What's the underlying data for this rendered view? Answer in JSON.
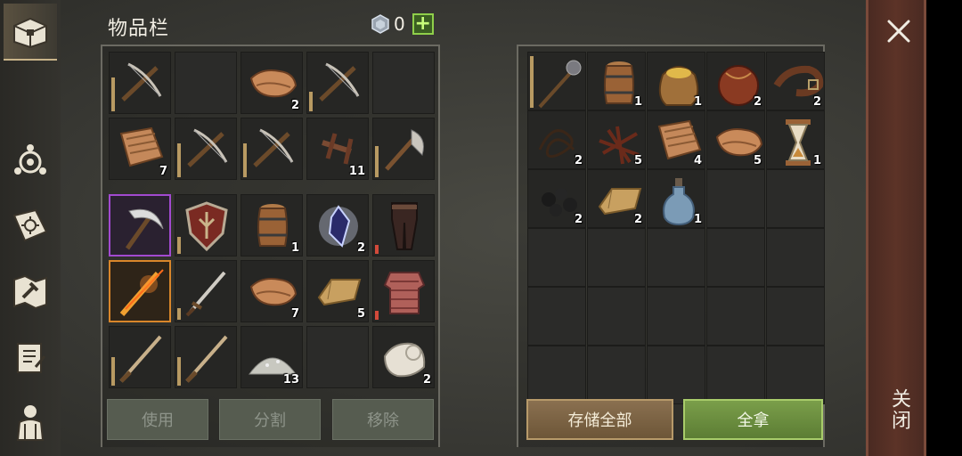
{
  "nav": {
    "items": [
      {
        "name": "storage-chest-icon",
        "active": true
      },
      {
        "name": "skills-icon",
        "active": false
      },
      {
        "name": "quest-book-icon",
        "active": false
      },
      {
        "name": "crafting-map-icon",
        "active": false
      },
      {
        "name": "recipe-scroll-icon",
        "active": false
      },
      {
        "name": "character-icon",
        "active": false
      }
    ]
  },
  "inventory": {
    "title": "物品栏",
    "currency": {
      "value": "0",
      "icon": "gem-icon",
      "add_label": "+"
    },
    "slots": [
      {
        "item": "crossbow",
        "count": "",
        "dur": 0.6
      },
      {
        "item": "",
        "count": ""
      },
      {
        "item": "leather",
        "count": "2"
      },
      {
        "item": "crossbow",
        "count": "",
        "dur": 0.35
      },
      {
        "item": "",
        "count": ""
      },
      {
        "item": "cloth",
        "count": "7"
      },
      {
        "item": "crossbow",
        "count": "",
        "dur": 0.6
      },
      {
        "item": "crossbow",
        "count": "",
        "dur": 0.6
      },
      {
        "item": "nails",
        "count": "11"
      },
      {
        "item": "axe",
        "count": "",
        "dur": 0.55
      },
      {
        "item": "scythe",
        "count": "",
        "rarity": "purple"
      },
      {
        "item": "shield",
        "count": "",
        "dur": 0.3
      },
      {
        "item": "barrel",
        "count": "1"
      },
      {
        "item": "crystal",
        "count": "2"
      },
      {
        "item": "pants",
        "count": "",
        "dur": 0.15,
        "durColor": "red"
      },
      {
        "item": "flame-sword",
        "count": "",
        "rarity": "orange"
      },
      {
        "item": "sword",
        "count": "",
        "dur": 0.2
      },
      {
        "item": "leather",
        "count": "7"
      },
      {
        "item": "ingot",
        "count": "5"
      },
      {
        "item": "chainmail",
        "count": "",
        "dur": 0.15,
        "durColor": "red"
      },
      {
        "item": "spear-blade",
        "count": "",
        "dur": 0.5
      },
      {
        "item": "spear-blade",
        "count": "",
        "dur": 0.5
      },
      {
        "item": "powder",
        "count": "13"
      },
      {
        "item": "",
        "count": ""
      },
      {
        "item": "bandage",
        "count": "2"
      }
    ],
    "buttons": {
      "use": "使用",
      "split": "分割",
      "remove": "移除"
    }
  },
  "stash": {
    "slots": [
      {
        "item": "mace",
        "count": "",
        "dur": 0.9
      },
      {
        "item": "barrel",
        "count": "1"
      },
      {
        "item": "grain-sack",
        "count": "1"
      },
      {
        "item": "leather-bag",
        "count": "2"
      },
      {
        "item": "belt",
        "count": "2"
      },
      {
        "item": "rope",
        "count": "2"
      },
      {
        "item": "fiber",
        "count": "5"
      },
      {
        "item": "cloth",
        "count": "4"
      },
      {
        "item": "leather",
        "count": "5"
      },
      {
        "item": "hourglass",
        "count": "1"
      },
      {
        "item": "coal",
        "count": "2"
      },
      {
        "item": "ingot",
        "count": "2"
      },
      {
        "item": "flask",
        "count": "1"
      }
    ],
    "buttons": {
      "store_all": "存储全部",
      "take_all": "全拿"
    }
  },
  "close": {
    "label": "关闭"
  },
  "colors": {
    "accent_green": "#8fcf4a",
    "rarity_purple": "#a24ad0",
    "rarity_orange": "#d9862a",
    "durability": "#b89a62",
    "durability_low": "#d24a3a"
  }
}
